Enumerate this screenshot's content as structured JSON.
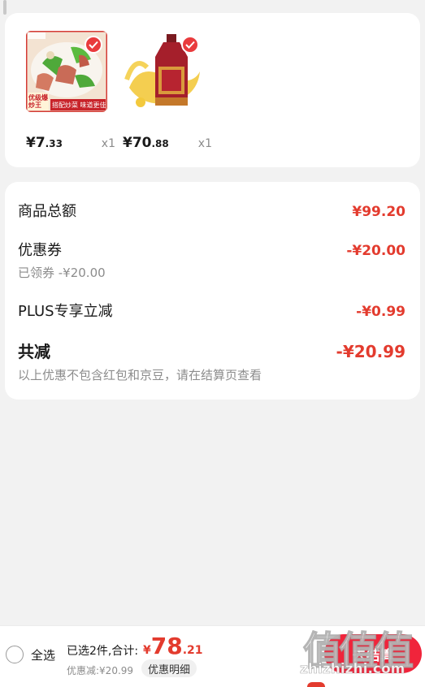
{
  "products": [
    {
      "name": "pork-stir-fry",
      "thumb_badge": "优级爆炒王",
      "thumb_caption": "搭配炒菜 味道更佳",
      "price_int": "¥7",
      "price_dec": ".33",
      "qty": "x1"
    },
    {
      "name": "cooking-oil",
      "price_int": "¥70",
      "price_dec": ".88",
      "qty": "x1"
    }
  ],
  "summary": {
    "goods_total_label": "商品总额",
    "goods_total_value": "¥99.20",
    "coupon_label": "优惠券",
    "coupon_value": "-¥20.00",
    "coupon_sub": "已领券 -¥20.00",
    "plus_label": "PLUS专享立减",
    "plus_value": "-¥0.99",
    "total_label": "共减",
    "total_value": "-¥20.99",
    "note": "以上优惠不包含红包和京豆，请在结算页查看"
  },
  "bottom": {
    "select_all": "全选",
    "selected_info": "已选2件,合计:",
    "amount_yen": "¥",
    "amount_int": "78",
    "amount_dec": ".21",
    "discount_info": "优惠减:¥20.99",
    "detail_button": "优惠明细",
    "checkout_button": "去结算"
  },
  "watermark": {
    "chars": "值值值",
    "url": "zhizhizhi.com"
  },
  "colors": {
    "accent": "#e33b2e",
    "checkout": "#f0243b"
  }
}
